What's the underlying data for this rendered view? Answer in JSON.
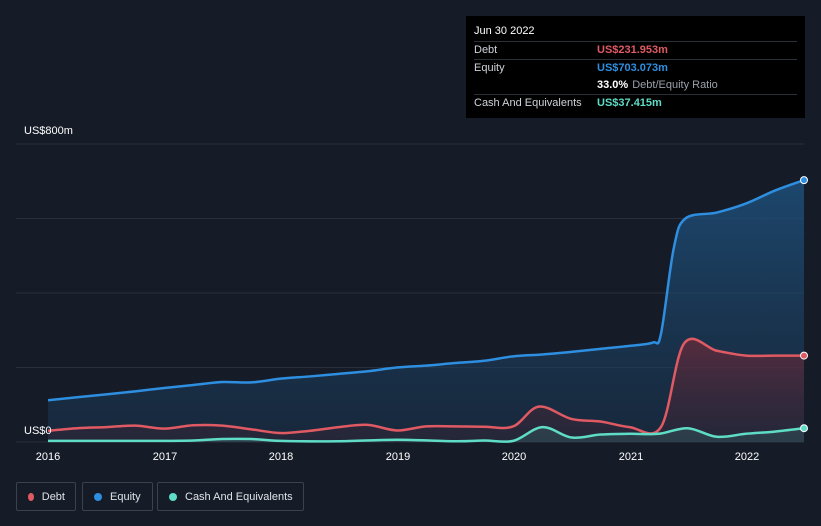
{
  "tooltip": {
    "date": "Jun 30 2022",
    "debt_label": "Debt",
    "debt_value": "US$231.953m",
    "equity_label": "Equity",
    "equity_value": "US$703.073m",
    "ratio_value": "33.0%",
    "ratio_label": "Debt/Equity Ratio",
    "cash_label": "Cash And Equivalents",
    "cash_value": "US$37.415m"
  },
  "legend": [
    {
      "label": "Debt",
      "color": "#e05a63"
    },
    {
      "label": "Equity",
      "color": "#2e8ee0"
    },
    {
      "label": "Cash And Equivalents",
      "color": "#5fdcc6"
    }
  ],
  "chart_data": {
    "type": "area",
    "y_top_label": "US$800m",
    "y_zero_label": "US$0",
    "ylim": [
      0,
      800
    ],
    "xlim": [
      2016.0,
      2022.5
    ],
    "x_ticks": [
      "2016",
      "2017",
      "2018",
      "2019",
      "2020",
      "2021",
      "2022"
    ],
    "grid": true,
    "legend_position": "bottom-left",
    "series": [
      {
        "name": "Equity",
        "color": "#2e8ee0",
        "points": [
          [
            2016.0,
            112
          ],
          [
            2016.25,
            120
          ],
          [
            2016.5,
            128
          ],
          [
            2016.75,
            136
          ],
          [
            2017.0,
            145
          ],
          [
            2017.25,
            153
          ],
          [
            2017.5,
            161
          ],
          [
            2017.75,
            160
          ],
          [
            2018.0,
            170
          ],
          [
            2018.25,
            176
          ],
          [
            2018.5,
            183
          ],
          [
            2018.75,
            190
          ],
          [
            2019.0,
            200
          ],
          [
            2019.25,
            205
          ],
          [
            2019.5,
            212
          ],
          [
            2019.75,
            218
          ],
          [
            2020.0,
            230
          ],
          [
            2020.25,
            235
          ],
          [
            2020.5,
            242
          ],
          [
            2020.75,
            250
          ],
          [
            2021.0,
            258
          ],
          [
            2021.2,
            267
          ],
          [
            2021.27,
            290
          ],
          [
            2021.38,
            520
          ],
          [
            2021.48,
            600
          ],
          [
            2021.75,
            616
          ],
          [
            2022.0,
            640
          ],
          [
            2022.25,
            675
          ],
          [
            2022.5,
            703
          ]
        ]
      },
      {
        "name": "Debt",
        "color": "#e05a63",
        "points": [
          [
            2016.0,
            30
          ],
          [
            2016.25,
            37
          ],
          [
            2016.5,
            40
          ],
          [
            2016.75,
            44
          ],
          [
            2017.0,
            36
          ],
          [
            2017.25,
            45
          ],
          [
            2017.5,
            44
          ],
          [
            2017.75,
            34
          ],
          [
            2018.0,
            24
          ],
          [
            2018.25,
            30
          ],
          [
            2018.5,
            40
          ],
          [
            2018.75,
            46
          ],
          [
            2019.0,
            31
          ],
          [
            2019.25,
            42
          ],
          [
            2019.5,
            42
          ],
          [
            2019.75,
            41
          ],
          [
            2020.0,
            42
          ],
          [
            2020.22,
            95
          ],
          [
            2020.5,
            62
          ],
          [
            2020.75,
            55
          ],
          [
            2021.0,
            40
          ],
          [
            2021.27,
            40
          ],
          [
            2021.47,
            265
          ],
          [
            2021.75,
            245
          ],
          [
            2022.0,
            232
          ],
          [
            2022.25,
            232
          ],
          [
            2022.5,
            232
          ]
        ]
      },
      {
        "name": "Cash And Equivalents",
        "color": "#5fdcc6",
        "points": [
          [
            2016.0,
            3
          ],
          [
            2016.5,
            3
          ],
          [
            2017.0,
            3
          ],
          [
            2017.25,
            4
          ],
          [
            2017.5,
            8
          ],
          [
            2017.75,
            8
          ],
          [
            2018.0,
            3
          ],
          [
            2018.5,
            2
          ],
          [
            2019.0,
            6
          ],
          [
            2019.5,
            2
          ],
          [
            2019.75,
            4
          ],
          [
            2020.0,
            3
          ],
          [
            2020.25,
            40
          ],
          [
            2020.5,
            12
          ],
          [
            2020.75,
            20
          ],
          [
            2021.0,
            22
          ],
          [
            2021.25,
            22
          ],
          [
            2021.5,
            37
          ],
          [
            2021.75,
            14
          ],
          [
            2022.0,
            22
          ],
          [
            2022.25,
            28
          ],
          [
            2022.5,
            37
          ]
        ]
      }
    ]
  }
}
